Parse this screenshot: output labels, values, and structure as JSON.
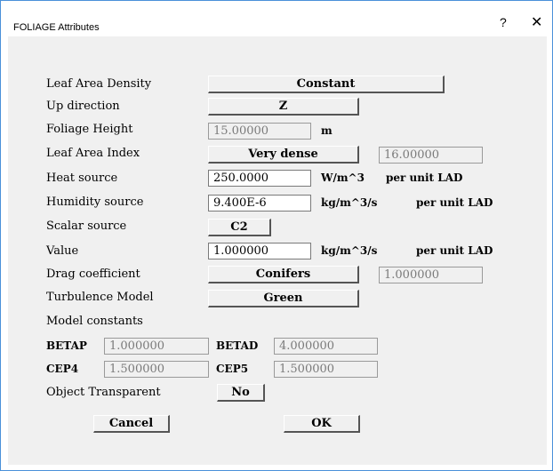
{
  "window": {
    "title": "FOLIAGE Attributes",
    "help": "?",
    "close": "✕"
  },
  "rows": {
    "lad": {
      "label": "Leaf Area Density",
      "button": "Constant"
    },
    "up": {
      "label": "Up direction",
      "button": "Z"
    },
    "height": {
      "label": "Foliage Height",
      "value": "15.00000",
      "unit": "m"
    },
    "lai": {
      "label": "Leaf Area Index",
      "button": "Very dense",
      "value": "16.00000"
    },
    "heat": {
      "label": "Heat source",
      "value": "250.0000",
      "unit": "W/m^3",
      "suffix": "per unit LAD"
    },
    "humidity": {
      "label": "Humidity source",
      "value": "9.400E-6",
      "unit": "kg/m^3/s",
      "suffix": "per unit LAD"
    },
    "scalar": {
      "label": "Scalar source",
      "button": "C2"
    },
    "value": {
      "label": "Value",
      "value": "1.000000",
      "unit": "kg/m^3/s",
      "suffix": "per unit LAD"
    },
    "drag": {
      "label": "Drag coefficient",
      "button": "Conifers",
      "value": "1.000000"
    },
    "turb": {
      "label": "Turbulence Model",
      "button": "Green"
    },
    "constants": {
      "label": "Model constants"
    },
    "betap": {
      "label": "BETAP",
      "value": "1.000000"
    },
    "betad": {
      "label": "BETAD",
      "value": "4.000000"
    },
    "cep4": {
      "label": "CEP4",
      "value": "1.500000"
    },
    "cep5": {
      "label": "CEP5",
      "value": "1.500000"
    },
    "transparent": {
      "label": "Object Transparent",
      "button": "No"
    }
  },
  "actions": {
    "cancel": "Cancel",
    "ok": "OK"
  }
}
